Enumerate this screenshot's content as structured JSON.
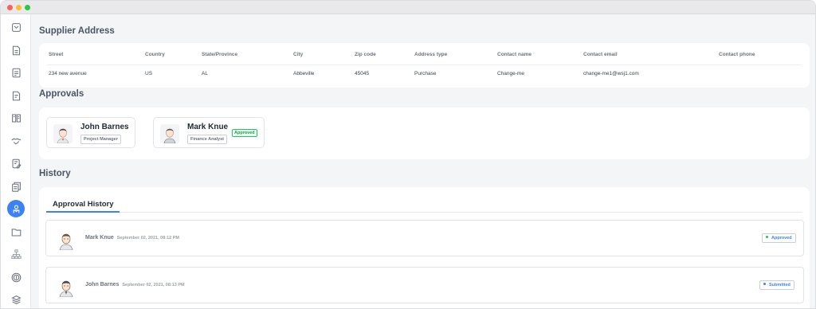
{
  "sidebar": {
    "icons": [
      "inbox-icon",
      "document-icon",
      "checklist-icon",
      "clipboard-icon",
      "book-icon",
      "handshake-icon",
      "edit-doc-icon",
      "files-icon",
      "approvals-icon",
      "folder-icon",
      "org-chart-icon",
      "dollar-icon",
      "layers-icon"
    ],
    "active_index": 8,
    "accent": "#3b82f6"
  },
  "supplier_address": {
    "title": "Supplier Address",
    "columns": [
      "Street",
      "Country",
      "State/Province",
      "City",
      "Zip code",
      "Address type",
      "Contact name",
      "Contact email",
      "Contact phone"
    ],
    "row": [
      "234 new avenue",
      "US",
      "AL",
      "Abbeville",
      "45045",
      "Purchase",
      "Change-me",
      "change-me1@wsj1.com",
      ""
    ]
  },
  "approvals": {
    "title": "Approvals",
    "approvers": [
      {
        "name": "John Barnes",
        "role": "Project Manager",
        "status": ""
      },
      {
        "name": "Mark Knue",
        "role": "Finance Analyst",
        "status": "Approved"
      }
    ]
  },
  "history": {
    "title": "History",
    "tab_label": "Approval History",
    "items": [
      {
        "name": "Mark Knue",
        "date": "September 02, 2021, 08:12 PM",
        "status": "Approved",
        "status_color": "#22c55e"
      },
      {
        "name": "John Barnes",
        "date": "September 02, 2021, 08:13 PM",
        "status": "Submitted",
        "status_color": "#3b82f6"
      }
    ]
  }
}
